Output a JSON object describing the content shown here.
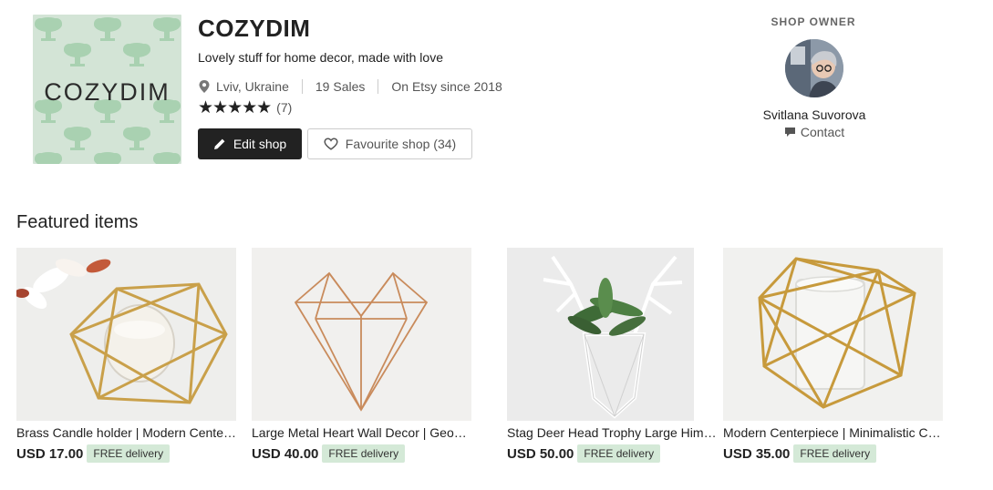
{
  "shop": {
    "logo_text": "COZYDIM",
    "name": "COZYDIM",
    "tagline": "Lovely stuff for home decor, made with love",
    "location": "Lviv, Ukraine",
    "sales": "19 Sales",
    "since": "On Etsy since 2018",
    "stars": "★★★★★",
    "rating_count": "(7)",
    "edit_label": "Edit shop",
    "favourite_label": "Favourite shop (34)"
  },
  "owner": {
    "label": "SHOP OWNER",
    "name": "Svitlana Suvorova",
    "contact_label": "Contact"
  },
  "featured": {
    "title": "Featured items",
    "items": [
      {
        "title": "Brass Candle holder | Modern Centerpiece",
        "price": "USD 17.00",
        "badge": "FREE delivery"
      },
      {
        "title": "Large Metal Heart Wall Decor | Geometric",
        "price": "USD 40.00",
        "badge": "FREE delivery"
      },
      {
        "title": "Stag Deer Head Trophy Large Himmeli",
        "price": "USD 50.00",
        "badge": "FREE delivery"
      },
      {
        "title": "Modern Centerpiece | Minimalistic Candle holder",
        "price": "USD 35.00",
        "badge": "FREE delivery"
      }
    ]
  },
  "colors": {
    "logo_background": "#d3e4d6",
    "button_dark": "#222222",
    "badge_green": "#d4e9d7"
  },
  "icons": [
    "map-pin-icon",
    "star-icon",
    "pencil-icon",
    "heart-icon",
    "message-icon"
  ]
}
